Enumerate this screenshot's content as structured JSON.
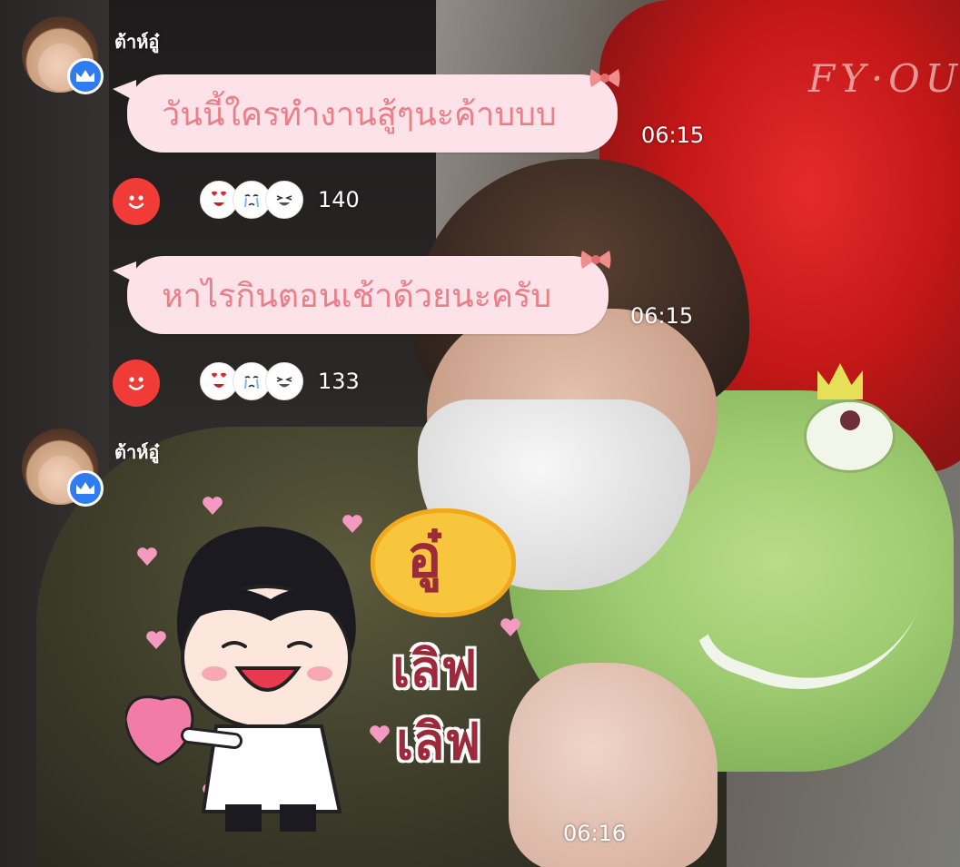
{
  "chat": {
    "sender_1": {
      "name": "ต้าห์อู๋",
      "badge_icon": "crown-icon"
    },
    "message_1": {
      "text": "วันนี้ใครทำงานสู้ๆนะค้าบบบ",
      "time": "06:15",
      "reaction_count": "140"
    },
    "message_2": {
      "text": "หาไรกินตอนเช้าด้วยนะครับ",
      "time": "06:15",
      "reaction_count": "133"
    },
    "sender_2": {
      "name": "ต้าห์อู๋",
      "badge_icon": "crown-icon"
    },
    "sticker": {
      "line_1": "อู๋",
      "line_2": "เลิฟ",
      "line_3": "เลิฟ",
      "time": "06:16"
    },
    "reaction_icons": [
      "heart-eyes-emoji",
      "crying-emoji",
      "laughing-emoji"
    ],
    "react_button_icon": "smile-icon"
  },
  "background": {
    "watermark": "FY·OU"
  },
  "colors": {
    "bubble_bg": "#fde2ea",
    "bubble_text": "#ea7f87",
    "badge_blue": "#2f7cf0",
    "react_red": "#f03b36"
  }
}
